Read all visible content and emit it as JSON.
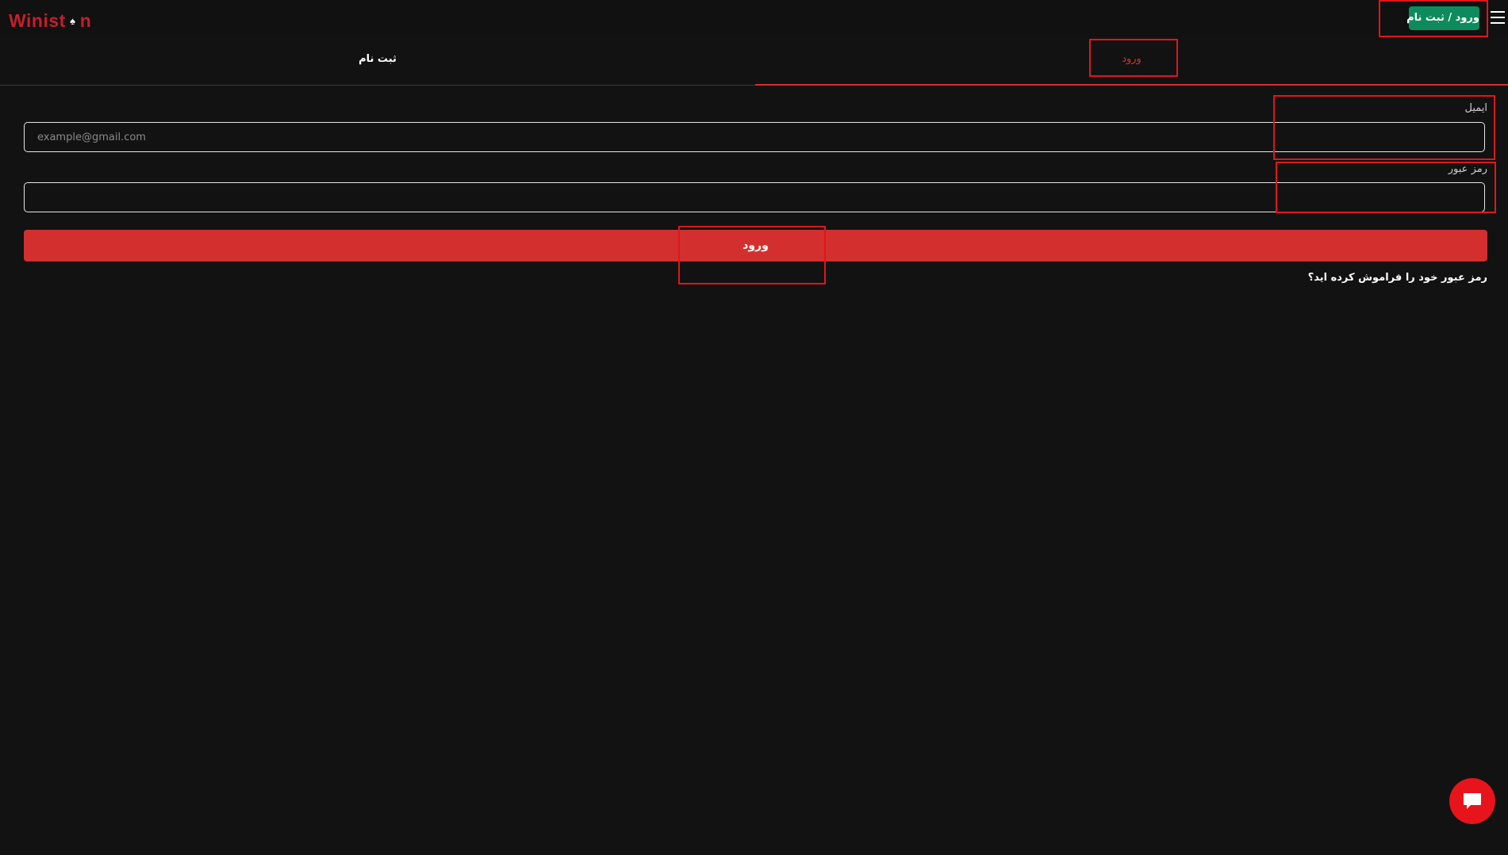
{
  "header": {
    "logo_text_before": "Winist",
    "logo_suit": "♠",
    "logo_text_after": "n",
    "auth_button_label": "ورود / ثبت نام",
    "menu_icon": "hamburger-menu-icon"
  },
  "tabs": [
    {
      "label": "ثبت نام",
      "active": false
    },
    {
      "label": "ورود",
      "active": true
    }
  ],
  "form": {
    "email": {
      "label": "ایمیل",
      "placeholder": "example@gmail.com",
      "value": ""
    },
    "password": {
      "label": "رمز عبور",
      "placeholder": "",
      "value": ""
    },
    "submit_label": "ورود",
    "forgot_password_label": "رمز عبور خود را فراموش کرده اید؟"
  },
  "chat": {
    "icon": "chat-bubble-icon"
  },
  "colors": {
    "background": "#121212",
    "accent_red": "#d32f2f",
    "auth_button_green": "#0d8b5d",
    "chat_button_red": "#e8141b",
    "highlight_box": "#e0161c"
  }
}
